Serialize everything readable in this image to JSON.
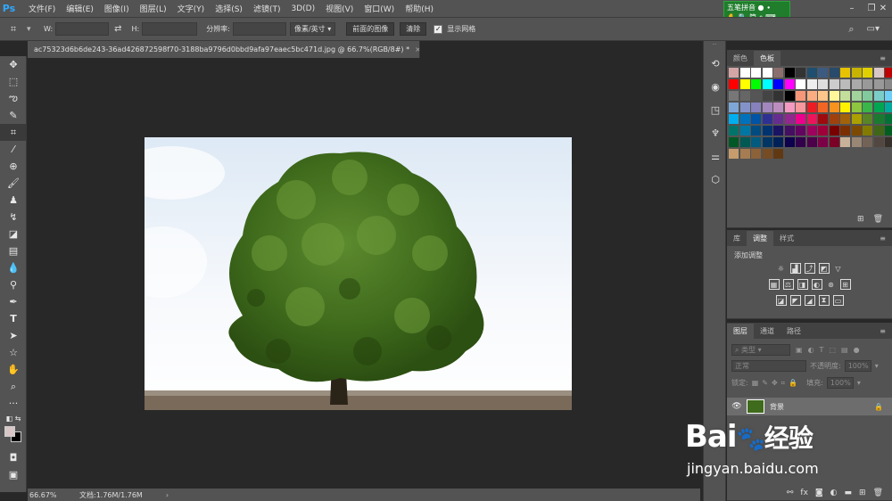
{
  "app": {
    "logo": "Ps"
  },
  "menu": [
    "文件(F)",
    "编辑(E)",
    "图像(I)",
    "图层(L)",
    "文字(Y)",
    "选择(S)",
    "滤镜(T)",
    "3D(D)",
    "视图(V)",
    "窗口(W)",
    "帮助(H)"
  ],
  "ime": {
    "line1": "五笔拼音",
    "line2": "简",
    "line3": "⌂"
  },
  "options": {
    "w_label": "W:",
    "h_label": "H:",
    "resolution_label": "分辨率:",
    "unit_select": "像素/英寸",
    "front_image_btn": "前面的图像",
    "clear_btn": "清除",
    "show_grid_label": "显示网格"
  },
  "document": {
    "tab_title": "ac75323d6b6de243-36ad426872598f70-3188ba9796d0bbd9afa97eaec5bc471d.jpg @ 66.7%(RGB/8#) *",
    "zoom": "66.67%",
    "doc_info": "文档:1.76M/1.76M"
  },
  "swatches_panel": {
    "tabs": [
      "颜色",
      "色板"
    ],
    "active_tab": "色板",
    "colors": [
      "#d4a5a5",
      "#ffffff",
      "#ffffff",
      "#ffffff",
      "#8b6e6e",
      "#000000",
      "#333333",
      "#1f4e6e",
      "#3d5a80",
      "#284a6b",
      "#e6c200",
      "#c8b400",
      "#e0d000",
      "#d9c7c7",
      "#c00000",
      "#ff0000",
      "#ffff00",
      "#00ff00",
      "#00ffff",
      "#0000ff",
      "#ff00ff",
      "#ffffff",
      "#eeeeee",
      "#dddddd",
      "#cccccc",
      "#bbbbbb",
      "#aaaaaa",
      "#999999",
      "#999999",
      "#888888",
      "#777777",
      "#666666",
      "#555555",
      "#444444",
      "#333333",
      "#000000",
      "#f7977a",
      "#f9ad81",
      "#fdc68a",
      "#fff79a",
      "#c4df9b",
      "#a2d39c",
      "#82ca9d",
      "#7bcdc8",
      "#6ecff6",
      "#7ea7d8",
      "#8393ca",
      "#8781bd",
      "#a187be",
      "#bc8dbf",
      "#f49ac2",
      "#f6989d",
      "#ed1c24",
      "#f26522",
      "#f7941d",
      "#fff200",
      "#8dc63f",
      "#39b54a",
      "#00a651",
      "#00a99d",
      "#00aeef",
      "#0072bc",
      "#0054a6",
      "#2e3192",
      "#662d91",
      "#92278f",
      "#ec008c",
      "#ed145b",
      "#9e0b0f",
      "#a0410d",
      "#a36209",
      "#aba000",
      "#598527",
      "#1a7b30",
      "#007236",
      "#00746b",
      "#0076a3",
      "#004b80",
      "#003471",
      "#1b1464",
      "#440e62",
      "#630460",
      "#9e005d",
      "#9e0039",
      "#790000",
      "#7b2e00",
      "#7d4900",
      "#827b00",
      "#406618",
      "#005e20",
      "#005826",
      "#005952",
      "#005b7f",
      "#003663",
      "#002157",
      "#0d004c",
      "#32004b",
      "#4b0049",
      "#7b0046",
      "#7a0026",
      "#c7b299",
      "#998675",
      "#736357",
      "#534741",
      "#37302a",
      "#c69c6d",
      "#a67c52",
      "#8c6239",
      "#754c24",
      "#603913"
    ]
  },
  "adjustments_panel": {
    "tabs": [
      "库",
      "调整",
      "样式"
    ],
    "active_tab": "调整",
    "heading": "添加调整"
  },
  "layers_panel": {
    "tabs": [
      "图层",
      "通道",
      "路径"
    ],
    "active_tab": "图层",
    "filter": "类型",
    "blend_mode": "正常",
    "opacity_label": "不透明度:",
    "opacity_value": "100%",
    "lock_label": "锁定:",
    "fill_label": "填充:",
    "fill_value": "100%",
    "layer_name": "背景"
  },
  "watermark": {
    "brand": "Bai",
    "brand_suffix": "经验",
    "url": "jingyan.baidu.com"
  }
}
